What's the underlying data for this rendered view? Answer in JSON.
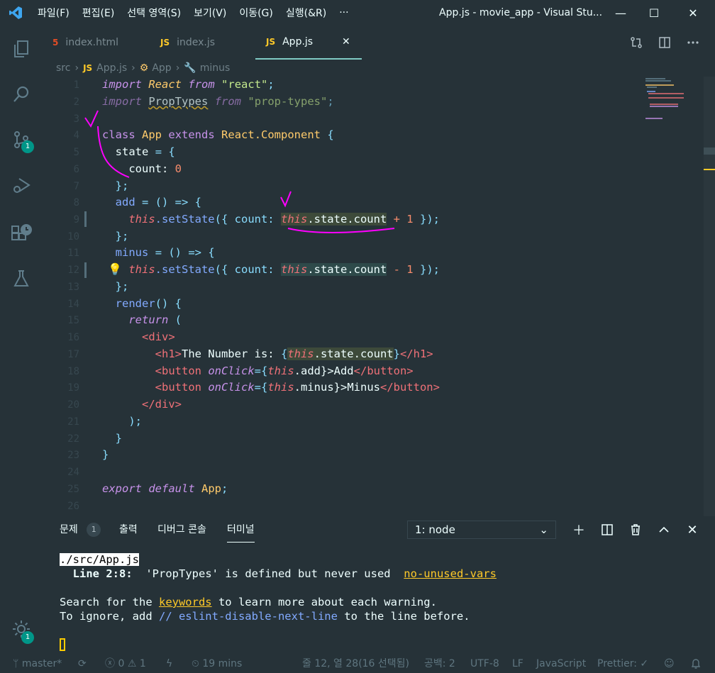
{
  "titlebar": {
    "menu": [
      "파일(F)",
      "편집(E)",
      "선택 영역(S)",
      "보기(V)",
      "이동(G)",
      "실행(&R)",
      "···"
    ],
    "window_title": "App.js - movie_app - Visual Stu...",
    "controls": {
      "minimize": "—",
      "maximize": "☐",
      "close": "✕"
    }
  },
  "activity": {
    "source_control_badge": "1",
    "accounts_badge": "1"
  },
  "tabs": [
    {
      "icon": "5",
      "label": "index.html",
      "active": false
    },
    {
      "icon": "JS",
      "label": "index.js",
      "active": false
    },
    {
      "icon": "JS",
      "label": "App.js",
      "active": true,
      "close": "✕"
    }
  ],
  "breadcrumb": {
    "folder": "src",
    "file_icon": "JS",
    "file": "App.js",
    "symbol1": "App",
    "symbol2": "minus"
  },
  "editor": {
    "line_numbers": [
      "1",
      "2",
      "3",
      "4",
      "5",
      "6",
      "7",
      "8",
      "9",
      "10",
      "11",
      "12",
      "13",
      "14",
      "15",
      "16",
      "17",
      "18",
      "19",
      "20",
      "21",
      "22",
      "23",
      "24",
      "25",
      "26"
    ],
    "tokens": {
      "import": "import",
      "react_ident": "React",
      "from": "from",
      "react_str": "\"react\"",
      "semi": ";",
      "proptypes": "PropTypes",
      "proptypes_str": "\"prop-types\"",
      "class": "class",
      "app": "App",
      "extends": "extends",
      "react_component": "React.Component",
      "brace_open": "{",
      "state": "state",
      "eq_brace": "= {",
      "count": "count:",
      "zero": "0",
      "close_brace_semi": "};",
      "add": "add",
      "arrow": "= () => {",
      "this": "this",
      "setstate": ".setState",
      "paren_obj": "({ count: ",
      "state_count": ".state.count",
      "plus_one": "+ 1",
      "minus_one": "- 1",
      "end_call": "});",
      "minus": "minus",
      "render": "render",
      "render_paren": "() {",
      "return": "return",
      "paren": "(",
      "div_open": "<div>",
      "h1_open": "<h1>",
      "h1_text": "The Number is: ",
      "h1_close": "</h1>",
      "button_open": "<button",
      "onclick": "onClick",
      "eq_brace2": "={",
      "add_prop": ".add",
      "add_text": "}>Add",
      "minus_prop": ".minus",
      "minus_text": "}>Minus",
      "button_close": "</button>",
      "div_close": "</div>",
      "paren_close": ");",
      "close_brace": "}",
      "export": "export",
      "default": "default"
    }
  },
  "panel": {
    "tabs": [
      {
        "label": "문제",
        "badge": "1"
      },
      {
        "label": "출력"
      },
      {
        "label": "디버그 콘솔"
      },
      {
        "label": "터미널",
        "active": true
      }
    ],
    "dropdown_value": "1: node",
    "terminal": {
      "file": "./src/App.js",
      "warning_loc": "Line 2:8:",
      "warning_msg": "'PropTypes' is defined but never used",
      "warning_rule": "no-unused-vars",
      "line1_a": "Search for the ",
      "line1_kw": "keywords",
      "line1_b": " to learn more about each warning.",
      "line2_a": "To ignore, add ",
      "line2_code": "// eslint-disable-next-line",
      "line2_b": " to the line before."
    }
  },
  "statusbar": {
    "branch": "master*",
    "errors": "0",
    "warnings": "1",
    "time": "19 mins",
    "cursor": "줄 12, 열 28(16 선택됨)",
    "spaces": "공백: 2",
    "encoding": "UTF-8",
    "eol": "LF",
    "language": "JavaScript",
    "prettier": "Prettier: ✓"
  },
  "colors": {
    "background": "#263238",
    "accent": "#80cbc4",
    "badge": "#009688",
    "annotation": "#ff00ff"
  }
}
